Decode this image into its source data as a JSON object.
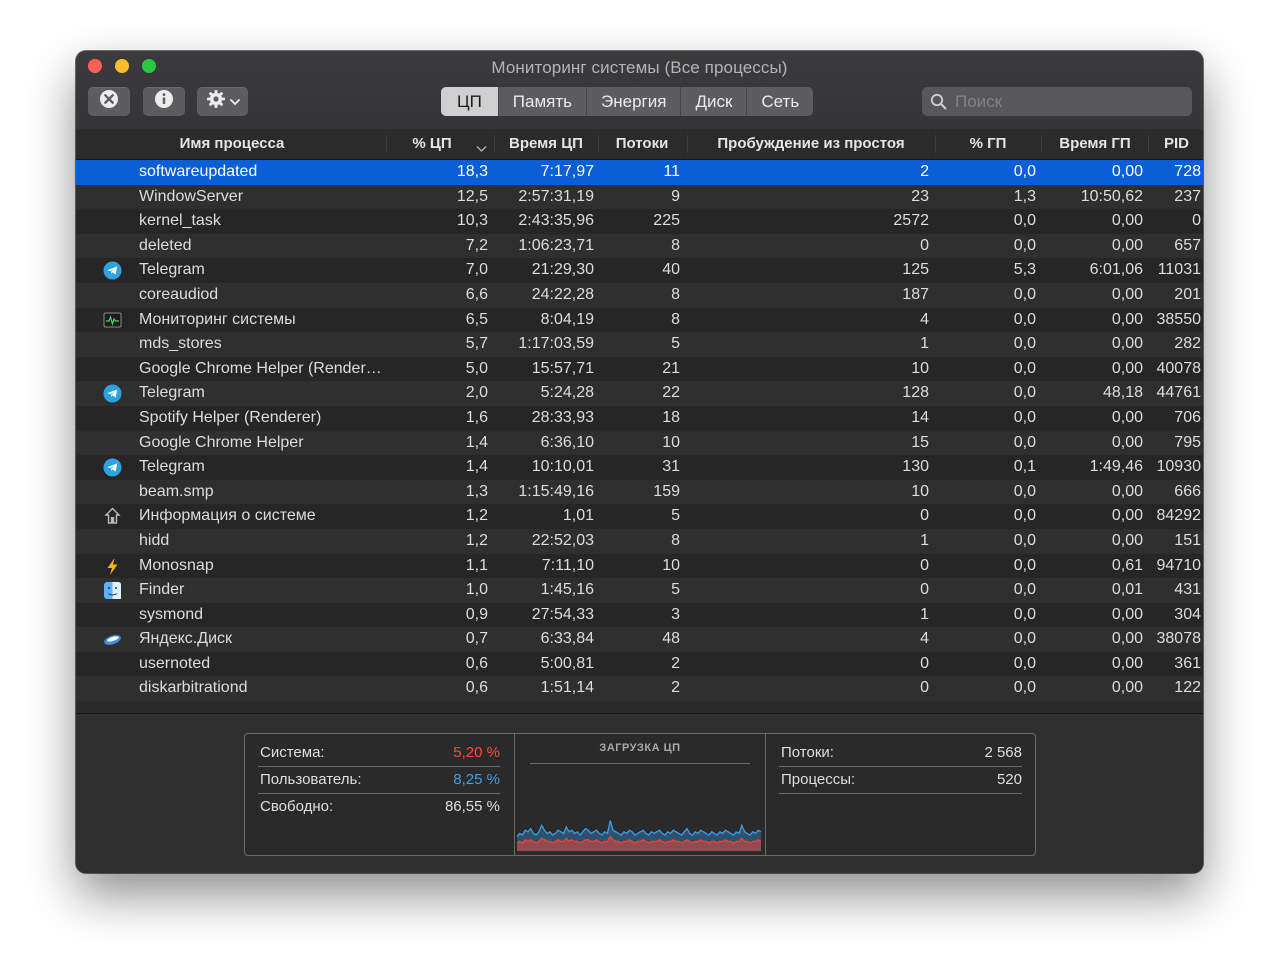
{
  "window": {
    "title": "Мониторинг системы (Все процессы)"
  },
  "toolbar": {
    "stop_icon": "x-circle-icon",
    "info_icon": "info-icon",
    "gear_icon": "gear-icon",
    "tabs": [
      "ЦП",
      "Память",
      "Энергия",
      "Диск",
      "Сеть"
    ],
    "active_tab": "ЦП",
    "search_placeholder": "Поиск"
  },
  "columns": [
    "Имя процесса",
    "% ЦП",
    "Время ЦП",
    "Потоки",
    "Пробуждение из простоя",
    "% ГП",
    "Время ГП",
    "PID"
  ],
  "rows": [
    {
      "name": "softwareupdated",
      "icon": "",
      "cpu": "18,3",
      "time": "7:17,97",
      "threads": "11",
      "wakeups": "2",
      "gpu": "0,0",
      "gpu_time": "0,00",
      "pid": "728",
      "selected": true
    },
    {
      "name": "WindowServer",
      "icon": "",
      "cpu": "12,5",
      "time": "2:57:31,19",
      "threads": "9",
      "wakeups": "23",
      "gpu": "1,3",
      "gpu_time": "10:50,62",
      "pid": "237"
    },
    {
      "name": "kernel_task",
      "icon": "",
      "cpu": "10,3",
      "time": "2:43:35,96",
      "threads": "225",
      "wakeups": "2572",
      "gpu": "0,0",
      "gpu_time": "0,00",
      "pid": "0"
    },
    {
      "name": "deleted",
      "icon": "",
      "cpu": "7,2",
      "time": "1:06:23,71",
      "threads": "8",
      "wakeups": "0",
      "gpu": "0,0",
      "gpu_time": "0,00",
      "pid": "657"
    },
    {
      "name": "Telegram",
      "icon": "telegram-icon",
      "cpu": "7,0",
      "time": "21:29,30",
      "threads": "40",
      "wakeups": "125",
      "gpu": "5,3",
      "gpu_time": "6:01,06",
      "pid": "11031"
    },
    {
      "name": "coreaudiod",
      "icon": "",
      "cpu": "6,6",
      "time": "24:22,28",
      "threads": "8",
      "wakeups": "187",
      "gpu": "0,0",
      "gpu_time": "0,00",
      "pid": "201"
    },
    {
      "name": "Мониторинг системы",
      "icon": "activity-monitor-icon",
      "cpu": "6,5",
      "time": "8:04,19",
      "threads": "8",
      "wakeups": "4",
      "gpu": "0,0",
      "gpu_time": "0,00",
      "pid": "38550"
    },
    {
      "name": "mds_stores",
      "icon": "",
      "cpu": "5,7",
      "time": "1:17:03,59",
      "threads": "5",
      "wakeups": "1",
      "gpu": "0,0",
      "gpu_time": "0,00",
      "pid": "282"
    },
    {
      "name": "Google Chrome Helper (Renderer)",
      "icon": "",
      "cpu": "5,0",
      "time": "15:57,71",
      "threads": "21",
      "wakeups": "10",
      "gpu": "0,0",
      "gpu_time": "0,00",
      "pid": "40078"
    },
    {
      "name": "Telegram",
      "icon": "telegram-icon",
      "cpu": "2,0",
      "time": "5:24,28",
      "threads": "22",
      "wakeups": "128",
      "gpu": "0,0",
      "gpu_time": "48,18",
      "pid": "44761"
    },
    {
      "name": "Spotify Helper (Renderer)",
      "icon": "",
      "cpu": "1,6",
      "time": "28:33,93",
      "threads": "18",
      "wakeups": "14",
      "gpu": "0,0",
      "gpu_time": "0,00",
      "pid": "706"
    },
    {
      "name": "Google Chrome Helper",
      "icon": "",
      "cpu": "1,4",
      "time": "6:36,10",
      "threads": "10",
      "wakeups": "15",
      "gpu": "0,0",
      "gpu_time": "0,00",
      "pid": "795"
    },
    {
      "name": "Telegram",
      "icon": "telegram-icon",
      "cpu": "1,4",
      "time": "10:10,01",
      "threads": "31",
      "wakeups": "130",
      "gpu": "0,1",
      "gpu_time": "1:49,46",
      "pid": "10930"
    },
    {
      "name": "beam.smp",
      "icon": "",
      "cpu": "1,3",
      "time": "1:15:49,16",
      "threads": "159",
      "wakeups": "10",
      "gpu": "0,0",
      "gpu_time": "0,00",
      "pid": "666"
    },
    {
      "name": "Информация о системе",
      "icon": "system-information-icon",
      "cpu": "1,2",
      "time": "1,01",
      "threads": "5",
      "wakeups": "0",
      "gpu": "0,0",
      "gpu_time": "0,00",
      "pid": "84292"
    },
    {
      "name": "hidd",
      "icon": "",
      "cpu": "1,2",
      "time": "22:52,03",
      "threads": "8",
      "wakeups": "1",
      "gpu": "0,0",
      "gpu_time": "0,00",
      "pid": "151"
    },
    {
      "name": "Monosnap",
      "icon": "monosnap-icon",
      "cpu": "1,1",
      "time": "7:11,10",
      "threads": "10",
      "wakeups": "0",
      "gpu": "0,0",
      "gpu_time": "0,61",
      "pid": "94710"
    },
    {
      "name": "Finder",
      "icon": "finder-icon",
      "cpu": "1,0",
      "time": "1:45,16",
      "threads": "5",
      "wakeups": "0",
      "gpu": "0,0",
      "gpu_time": "0,01",
      "pid": "431"
    },
    {
      "name": "sysmond",
      "icon": "",
      "cpu": "0,9",
      "time": "27:54,33",
      "threads": "3",
      "wakeups": "1",
      "gpu": "0,0",
      "gpu_time": "0,00",
      "pid": "304"
    },
    {
      "name": "Яндекс.Диск",
      "icon": "yandex-disk-icon",
      "cpu": "0,7",
      "time": "6:33,84",
      "threads": "48",
      "wakeups": "4",
      "gpu": "0,0",
      "gpu_time": "0,00",
      "pid": "38078"
    },
    {
      "name": "usernoted",
      "icon": "",
      "cpu": "0,6",
      "time": "5:00,81",
      "threads": "2",
      "wakeups": "0",
      "gpu": "0,0",
      "gpu_time": "0,00",
      "pid": "361"
    },
    {
      "name": "diskarbitrationd",
      "icon": "",
      "cpu": "0,6",
      "time": "1:51,14",
      "threads": "2",
      "wakeups": "0",
      "gpu": "0,0",
      "gpu_time": "0,00",
      "pid": "122"
    }
  ],
  "summary": {
    "system_label": "Система:",
    "system_value": "5,20 %",
    "user_label": "Пользователь:",
    "user_value": "8,25 %",
    "idle_label": "Свободно:",
    "idle_value": "86,55 %",
    "graph_title": "ЗАГРУЗКА ЦП",
    "threads_label": "Потоки:",
    "threads_value": "2 568",
    "processes_label": "Процессы:",
    "processes_value": "520"
  },
  "cpu_graph": {
    "user": [
      9,
      11,
      10,
      13,
      12,
      14,
      11,
      10,
      12,
      16,
      13,
      11,
      12,
      10,
      11,
      13,
      12,
      11,
      15,
      12,
      13,
      11,
      12,
      10,
      12,
      14,
      13,
      11,
      12,
      13,
      11,
      10,
      12,
      11,
      19,
      13,
      12,
      11,
      10,
      12,
      11,
      13,
      12,
      10,
      11,
      12,
      13,
      11,
      10,
      12,
      11,
      12,
      13,
      11,
      10,
      12,
      11,
      13,
      12,
      11,
      10,
      12,
      14,
      11,
      10,
      12,
      11,
      13,
      12,
      11,
      10,
      12,
      11,
      10,
      12,
      11,
      13,
      12,
      11,
      10,
      12,
      11,
      16,
      12,
      11,
      10,
      12,
      11,
      13,
      12
    ],
    "system": [
      5,
      6,
      5,
      7,
      6,
      7,
      6,
      5,
      6,
      8,
      7,
      6,
      6,
      5,
      6,
      7,
      6,
      6,
      8,
      6,
      7,
      6,
      6,
      5,
      6,
      7,
      7,
      6,
      6,
      7,
      6,
      5,
      6,
      6,
      9,
      7,
      6,
      6,
      5,
      6,
      6,
      7,
      6,
      5,
      6,
      6,
      7,
      6,
      5,
      6,
      6,
      6,
      7,
      6,
      5,
      6,
      6,
      7,
      6,
      6,
      5,
      6,
      7,
      6,
      5,
      6,
      6,
      7,
      6,
      6,
      5,
      6,
      6,
      5,
      6,
      6,
      7,
      6,
      6,
      5,
      6,
      6,
      8,
      6,
      6,
      5,
      6,
      6,
      7,
      6
    ],
    "colors": {
      "user": "#3d9be9",
      "system": "#e5473c",
      "system_value": "#ff4a3d",
      "user_value": "#3aa0ec",
      "selection": "#0a5fd6"
    }
  }
}
